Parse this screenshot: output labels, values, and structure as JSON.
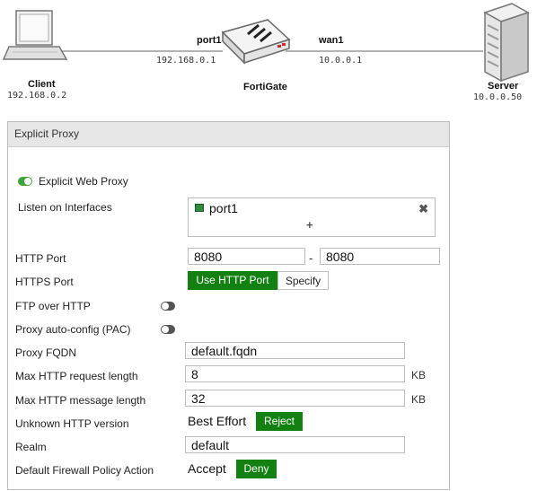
{
  "diagram": {
    "client": {
      "label": "Client",
      "ip": "192.168.0.2"
    },
    "fortigate": {
      "label": "FortiGate"
    },
    "server": {
      "label": "Server",
      "ip": "10.0.0.50"
    },
    "port1": {
      "label": "port1",
      "ip": "192.168.0.1"
    },
    "wan1": {
      "label": "wan1",
      "ip": "10.0.0.1"
    }
  },
  "panel": {
    "title": "Explicit Proxy",
    "web_proxy_label": "Explicit Web Proxy",
    "web_proxy_enabled": true,
    "listen_label": "Listen on Interfaces",
    "listen_interface": "port1",
    "add_symbol": "+",
    "remove_symbol": "✖",
    "http_port_label": "HTTP Port",
    "http_port_from": "8080",
    "http_port_sep": "-",
    "http_port_to": "8080",
    "https_port_label": "HTTPS Port",
    "https_port_options": [
      "Use HTTP Port",
      "Specify"
    ],
    "https_port_selected": "Use HTTP Port",
    "ftp_over_http_label": "FTP over HTTP",
    "ftp_over_http_enabled": false,
    "pac_label": "Proxy auto-config (PAC)",
    "pac_enabled": false,
    "fqdn_label": "Proxy FQDN",
    "fqdn_value": "default.fqdn",
    "max_req_label": "Max HTTP request length",
    "max_req_value": "8",
    "max_req_unit": "KB",
    "max_msg_label": "Max HTTP message length",
    "max_msg_value": "32",
    "max_msg_unit": "KB",
    "unknown_ver_label": "Unknown HTTP version",
    "unknown_ver_options": [
      "Best Effort",
      "Reject"
    ],
    "unknown_ver_selected": "Reject",
    "realm_label": "Realm",
    "realm_value": "default",
    "policy_label": "Default Firewall Policy Action",
    "policy_options": [
      "Accept",
      "Deny"
    ],
    "policy_selected": "Deny"
  },
  "colors": {
    "accent_green": "#128112",
    "toggle_on": "#3aa33a",
    "header_bg": "#e6e6e6"
  }
}
